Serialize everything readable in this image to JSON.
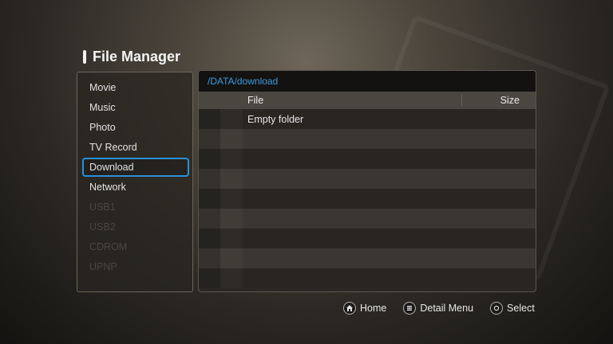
{
  "title": "File Manager",
  "sidebar": {
    "items": [
      {
        "label": "Movie",
        "state": "normal"
      },
      {
        "label": "Music",
        "state": "normal"
      },
      {
        "label": "Photo",
        "state": "normal"
      },
      {
        "label": "TV Record",
        "state": "normal"
      },
      {
        "label": "Download",
        "state": "selected"
      },
      {
        "label": "Network",
        "state": "normal"
      },
      {
        "label": "USB1",
        "state": "disabled"
      },
      {
        "label": "USB2",
        "state": "disabled"
      },
      {
        "label": "CDROM",
        "state": "disabled"
      },
      {
        "label": "UPNP",
        "state": "disabled"
      }
    ]
  },
  "browser": {
    "path": "/DATA/download",
    "columns": {
      "file": "File",
      "size": "Size"
    },
    "empty_message": "Empty folder"
  },
  "footer": {
    "home": {
      "label": "Home",
      "icon": "home-icon"
    },
    "detail_menu": {
      "label": "Detail Menu",
      "icon": "menu-icon"
    },
    "select": {
      "label": "Select",
      "icon": "ok-icon"
    }
  },
  "colors": {
    "accent": "#2a90d8",
    "path_text": "#3f9be0",
    "disabled_text": "#4a4640"
  }
}
